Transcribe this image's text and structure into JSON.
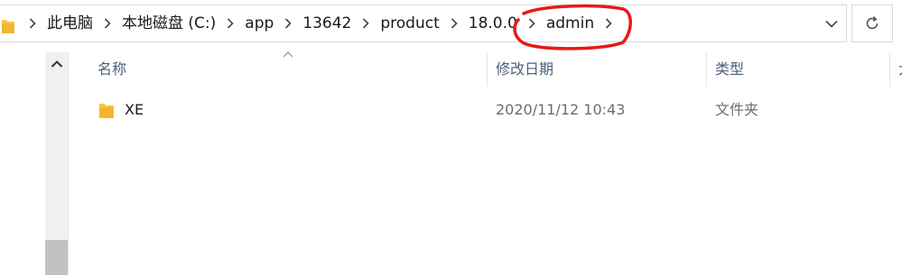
{
  "address_bar": {
    "breadcrumbs": [
      "此电脑",
      "本地磁盘 (C:)",
      "app",
      "13642",
      "product",
      "18.0.0",
      "admin"
    ]
  },
  "columns": {
    "name": "名称",
    "date_modified": "修改日期",
    "type": "类型",
    "size_partial": "大"
  },
  "files": [
    {
      "name": "XE",
      "date_modified": "2020/11/12 10:43",
      "type": "文件夹"
    }
  ],
  "icons": {
    "address_folder": "folder-icon",
    "separator": "chevron-right-icon",
    "dropdown": "chevron-down-icon",
    "refresh": "refresh-icon",
    "scroll_up": "chevron-up-icon",
    "sort": "sort-ascending-icon",
    "row_folder": "folder-icon"
  },
  "colors": {
    "folder_yellow": "#f8c649",
    "annotation_red": "#e81919",
    "header_text": "#4c607a"
  }
}
